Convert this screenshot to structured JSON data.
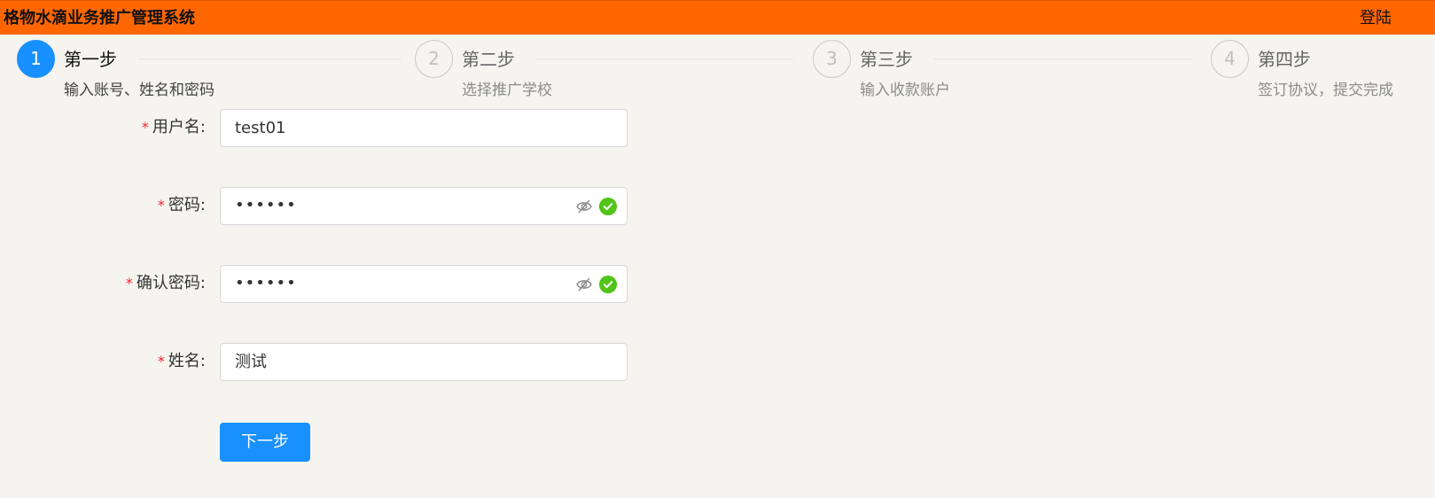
{
  "header": {
    "title": "格物水滴业务推广管理系统",
    "login_label": "登陆"
  },
  "steps": [
    {
      "number": "1",
      "title": "第一步",
      "desc": "输入账号、姓名和密码",
      "active": true
    },
    {
      "number": "2",
      "title": "第二步",
      "desc": "选择推广学校",
      "active": false
    },
    {
      "number": "3",
      "title": "第三步",
      "desc": "输入收款账户",
      "active": false
    },
    {
      "number": "4",
      "title": "第四步",
      "desc": "签订协议，提交完成",
      "active": false
    }
  ],
  "form": {
    "required_mark": "*",
    "username": {
      "label": "用户名:",
      "value": "test01"
    },
    "password": {
      "label": "密码:",
      "value": "••••••"
    },
    "confirm_password": {
      "label": "确认密码:",
      "value": "••••••"
    },
    "name": {
      "label": "姓名:",
      "value": "测试"
    },
    "next_label": "下一步"
  },
  "icons": {
    "eye": "eye-invisible-icon",
    "check": "check-circle-icon"
  },
  "colors": {
    "header_bg": "#ff6600",
    "accent": "#1890ff",
    "success": "#52c41a",
    "required": "#f5222d"
  }
}
